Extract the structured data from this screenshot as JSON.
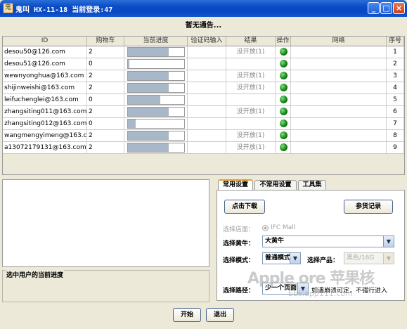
{
  "window": {
    "title": "鬼叫 HX-11-18 当前登录:47",
    "icon_glyph": "鬼"
  },
  "notice": "暂无通告...",
  "table": {
    "headers": [
      "ID",
      "购物车",
      "当前进度",
      "验证码输入",
      "结果",
      "操作",
      "网络",
      "序号"
    ],
    "rows": [
      {
        "id": "desou50@126.com",
        "cart": "2",
        "progress": 0.73,
        "captcha": "",
        "result": "没开放(1)",
        "op": "green-dot",
        "net": "",
        "seq": "1"
      },
      {
        "id": "desou51@126.com",
        "cart": "0",
        "progress": 0.03,
        "captcha": "",
        "result": "",
        "op": "green-dot",
        "net": "",
        "seq": "2"
      },
      {
        "id": "wewnyonghua@163.com",
        "cart": "2",
        "progress": 0.73,
        "captcha": "",
        "result": "没开放(1)",
        "op": "green-dot",
        "net": "",
        "seq": "3"
      },
      {
        "id": "shijinweishi@163.com",
        "cart": "2",
        "progress": 0.73,
        "captcha": "",
        "result": "没开放(1)",
        "op": "green-dot",
        "net": "",
        "seq": "4"
      },
      {
        "id": "leifuchenglei@163.com",
        "cart": "0",
        "progress": 0.57,
        "captcha": "",
        "result": "",
        "op": "green-dot",
        "net": "",
        "seq": "5"
      },
      {
        "id": "zhangsiting011@163.com",
        "cart": "2",
        "progress": 0.73,
        "captcha": "",
        "result": "没开放(1)",
        "op": "green-dot",
        "net": "",
        "seq": "6"
      },
      {
        "id": "zhangsiting012@163.com",
        "cart": "0",
        "progress": 0.14,
        "captcha": "",
        "result": "",
        "op": "green-dot",
        "net": "",
        "seq": "7"
      },
      {
        "id": "wangmengyimeng@163.com",
        "cart": "2",
        "progress": 0.73,
        "captcha": "",
        "result": "没开放(1)",
        "op": "green-dot",
        "net": "",
        "seq": "8"
      },
      {
        "id": "a13072179131@163.com",
        "cart": "2",
        "progress": 0.73,
        "captcha": "",
        "result": "没开放(1)",
        "op": "green-dot",
        "net": "",
        "seq": "9"
      }
    ]
  },
  "progress_group": {
    "label": "选中用户的当前进度"
  },
  "tabs": [
    {
      "label": "常用设置",
      "active": true
    },
    {
      "label": "不常用设置",
      "active": false
    },
    {
      "label": "工具集",
      "active": false
    }
  ],
  "panel": {
    "download_button": "点击下载",
    "record_button": "参货记录",
    "store_label": "选择店面：",
    "store_option": "IFC Mall",
    "bull_label": "选择黄牛：",
    "bull_value": "大黄牛",
    "mode_label": "选择模式：",
    "mode_value": "普通模式",
    "product_label": "选择产品：",
    "product_value": "黑色/16G",
    "path_label": "选择路径：",
    "path_value": "少一个页面",
    "path_note": "如遇崩溃可定，不强行进入"
  },
  "watermark": {
    "text": "Apple ore 苹果核",
    "site": "bbs.app111.com"
  },
  "bottom": {
    "start_button": "开始",
    "exit_button": "退出"
  },
  "colors": {
    "titlebar": "#0b4bc4",
    "progress_fill": "#a8b8c8",
    "status_green": "#108010"
  },
  "window_controls": {
    "minimize": "_",
    "maximize": "□",
    "close": "×"
  }
}
